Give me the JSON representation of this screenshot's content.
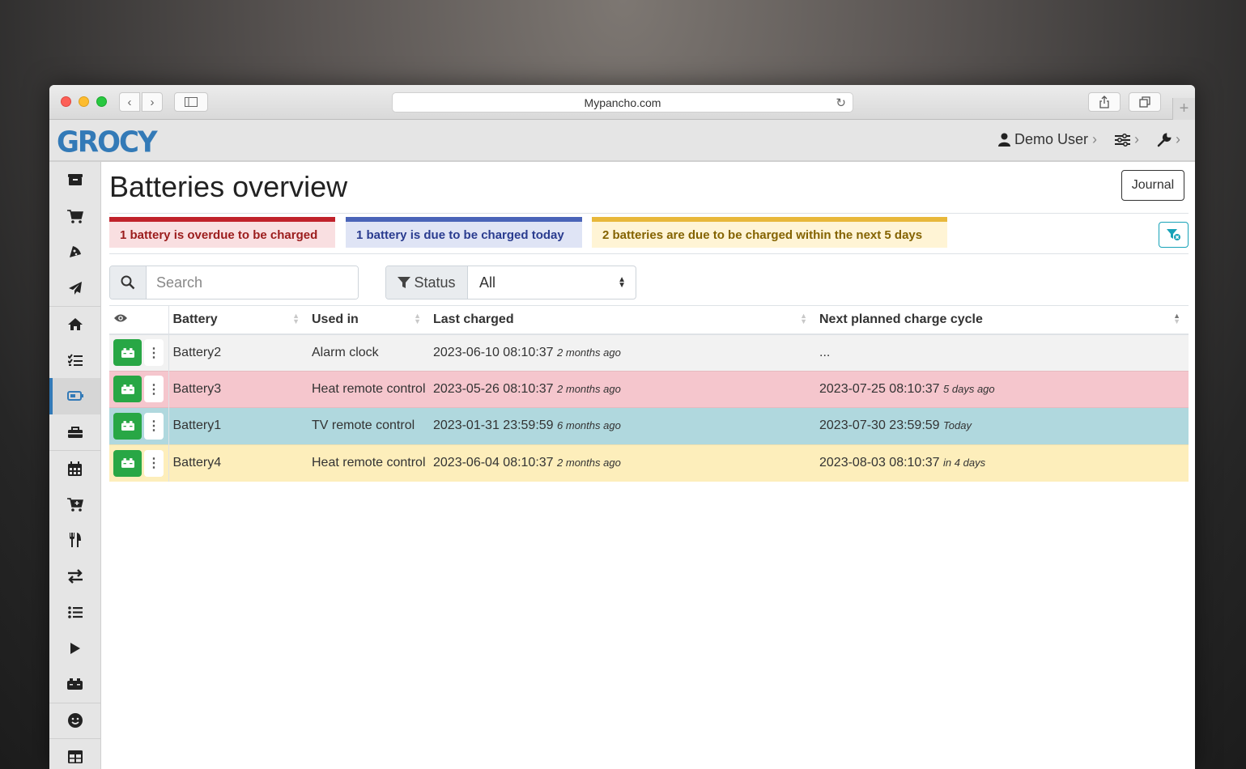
{
  "browser": {
    "url": "Mypancho.com",
    "new_tab_symbol": "+"
  },
  "app": {
    "logo_text": "GROCY",
    "user_name": "Demo User"
  },
  "page": {
    "title": "Batteries overview",
    "journal_label": "Journal"
  },
  "alerts": {
    "overdue": "1 battery is overdue to be charged",
    "due_today": "1 battery is due to be charged today",
    "due_soon": "2 batteries are due to be charged within the next 5 days"
  },
  "filters": {
    "search_placeholder": "Search",
    "status_label": "Status",
    "status_value": "All"
  },
  "table": {
    "headers": {
      "battery": "Battery",
      "used_in": "Used in",
      "last_charged": "Last charged",
      "next_cycle": "Next planned charge cycle"
    },
    "rows": [
      {
        "battery": "Battery2",
        "used_in": "Alarm clock",
        "last_charged": "2023-06-10 08:10:37",
        "last_rel": "2 months ago",
        "next": "...",
        "next_rel": ""
      },
      {
        "battery": "Battery3",
        "used_in": "Heat remote control",
        "last_charged": "2023-05-26 08:10:37",
        "last_rel": "2 months ago",
        "next": "2023-07-25 08:10:37",
        "next_rel": "5 days ago"
      },
      {
        "battery": "Battery1",
        "used_in": "TV remote control",
        "last_charged": "2023-01-31 23:59:59",
        "last_rel": "6 months ago",
        "next": "2023-07-30 23:59:59",
        "next_rel": "Today"
      },
      {
        "battery": "Battery4",
        "used_in": "Heat remote control",
        "last_charged": "2023-06-04 08:10:37",
        "last_rel": "2 months ago",
        "next": "2023-08-03 08:10:37",
        "next_rel": "in 4 days"
      }
    ]
  },
  "icons": {
    "leftnav": [
      "box-icon",
      "cart-icon",
      "pizza-icon",
      "paper-plane-icon",
      "home-icon",
      "tasks-icon",
      "battery-icon",
      "toolbox-icon",
      "calendar-icon",
      "cart-plus-icon",
      "utensils-icon",
      "exchange-icon",
      "list-icon",
      "play-icon",
      "car-battery-icon",
      "smile-icon",
      "table-icon"
    ]
  },
  "colors": {
    "brand": "#337ab7",
    "danger": "#c0222b",
    "primary": "#4a64b8",
    "warning": "#e8b83b",
    "success": "#28a745",
    "info": "#17a2b8"
  }
}
